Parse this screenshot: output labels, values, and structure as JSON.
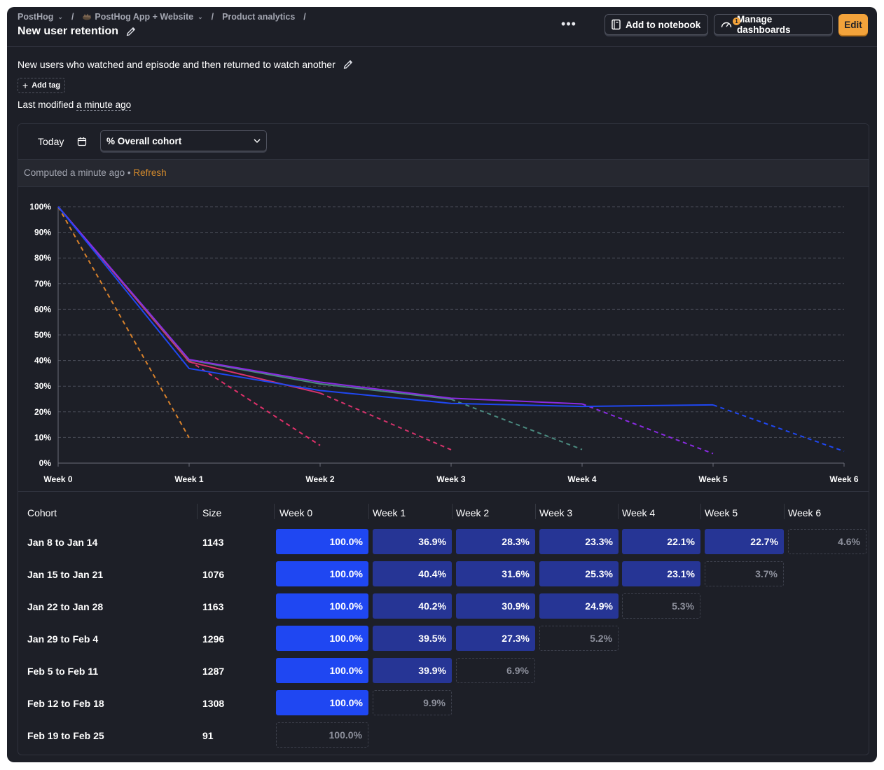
{
  "breadcrumbs": [
    {
      "label": "PostHog",
      "dropdown": true
    },
    {
      "label": "PostHog App + Website",
      "dropdown": true
    },
    {
      "label": "Product analytics",
      "dropdown": false
    }
  ],
  "title": "New user retention",
  "toolbar": {
    "more": "•••",
    "add_to_notebook": "Add to notebook",
    "manage_dashboards": "Manage dashboards",
    "dashboards_badge": "1",
    "edit": "Edit"
  },
  "description": "New users who watched and episode and then returned to watch another",
  "add_tag": "Add tag",
  "last_modified": {
    "prefix": "Last modified ",
    "when": "a minute ago"
  },
  "filters": {
    "date": "Today",
    "mode": "% Overall cohort"
  },
  "computed": {
    "text": "Computed a minute ago",
    "dot": " • ",
    "refresh": "Refresh"
  },
  "colors": {
    "accent": "#f3a33b",
    "full": "#1f47f2",
    "mid": "#263595",
    "bg": "#1d1f27"
  },
  "chart_data": {
    "type": "line",
    "x": [
      "Week 0",
      "Week 1",
      "Week 2",
      "Week 3",
      "Week 4",
      "Week 5",
      "Week 6"
    ],
    "y_ticks": [
      "0%",
      "10%",
      "20%",
      "30%",
      "40%",
      "50%",
      "60%",
      "70%",
      "80%",
      "90%",
      "100%"
    ],
    "ylim": [
      0,
      100
    ],
    "grid": true,
    "series": [
      {
        "color": "#1f47f2",
        "values": [
          100,
          36.9,
          28.3,
          23.3,
          22.1,
          22.7,
          4.6
        ]
      },
      {
        "color": "#8a2be2",
        "values": [
          100,
          40.4,
          31.6,
          25.3,
          23.1,
          3.7
        ]
      },
      {
        "color": "#4a8a7f",
        "values": [
          100,
          40.2,
          30.9,
          24.9,
          5.3
        ]
      },
      {
        "color": "#d6336c",
        "values": [
          100,
          39.5,
          27.3,
          5.2
        ]
      },
      {
        "color": "#e0306a",
        "values": [
          100,
          39.9,
          6.9
        ]
      },
      {
        "color": "#d9822b",
        "values": [
          100,
          9.9
        ]
      }
    ]
  },
  "table": {
    "headers": [
      "Cohort",
      "Size",
      "Week 0",
      "Week 1",
      "Week 2",
      "Week 3",
      "Week 4",
      "Week 5",
      "Week 6"
    ],
    "rows": [
      {
        "cohort": "Jan 8 to Jan 14",
        "size": "1143",
        "values": [
          "100.0%",
          "36.9%",
          "28.3%",
          "23.3%",
          "22.1%",
          "22.7%",
          "4.6%"
        ]
      },
      {
        "cohort": "Jan 15 to Jan 21",
        "size": "1076",
        "values": [
          "100.0%",
          "40.4%",
          "31.6%",
          "25.3%",
          "23.1%",
          "3.7%"
        ]
      },
      {
        "cohort": "Jan 22 to Jan 28",
        "size": "1163",
        "values": [
          "100.0%",
          "40.2%",
          "30.9%",
          "24.9%",
          "5.3%"
        ]
      },
      {
        "cohort": "Jan 29 to Feb 4",
        "size": "1296",
        "values": [
          "100.0%",
          "39.5%",
          "27.3%",
          "5.2%"
        ]
      },
      {
        "cohort": "Feb 5 to Feb 11",
        "size": "1287",
        "values": [
          "100.0%",
          "39.9%",
          "6.9%"
        ]
      },
      {
        "cohort": "Feb 12 to Feb 18",
        "size": "1308",
        "values": [
          "100.0%",
          "9.9%"
        ]
      },
      {
        "cohort": "Feb 19 to Feb 25",
        "size": "91",
        "values": [
          "100.0%"
        ]
      }
    ]
  }
}
